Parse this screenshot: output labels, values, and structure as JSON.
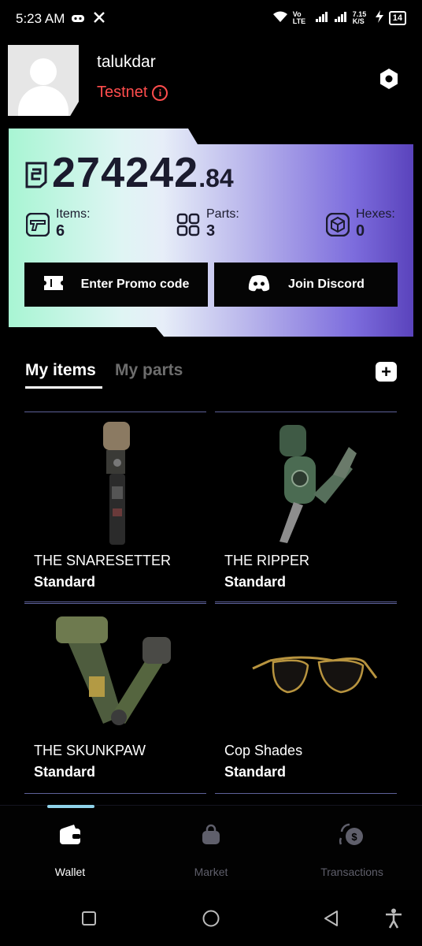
{
  "status_bar": {
    "time": "5:23 AM",
    "network_label": "Vo LTE",
    "speed": "7.15 K/S",
    "battery": "14"
  },
  "profile": {
    "username": "talukdar",
    "network": "Testnet",
    "network_color": "#ff4d4d"
  },
  "wallet": {
    "balance_int": "274242",
    "balance_dec": ".84",
    "stats": [
      {
        "label": "Items:",
        "value": "6"
      },
      {
        "label": "Parts:",
        "value": "3"
      },
      {
        "label": "Hexes:",
        "value": "0"
      }
    ],
    "promo_label": "Enter Promo code",
    "discord_label": "Join Discord"
  },
  "tabs": [
    {
      "label": "My items",
      "active": true
    },
    {
      "label": "My parts",
      "active": false
    }
  ],
  "items": [
    {
      "name": "THE SNARESETTER",
      "rarity": "Standard"
    },
    {
      "name": "THE RIPPER",
      "rarity": "Standard"
    },
    {
      "name": "THE SKUNKPAW",
      "rarity": "Standard"
    },
    {
      "name": "Cop Shades",
      "rarity": "Standard"
    }
  ],
  "nav": [
    {
      "label": "Wallet",
      "icon": "wallet-icon",
      "active": true
    },
    {
      "label": "Market",
      "icon": "bag-icon",
      "active": false
    },
    {
      "label": "Transactions",
      "icon": "coins-exchange-icon",
      "active": false
    }
  ],
  "colors": {
    "nav_inactive": "#5f5f6b",
    "nav_active": "#ffffff",
    "accent_indicator": "#8fd3ea"
  }
}
